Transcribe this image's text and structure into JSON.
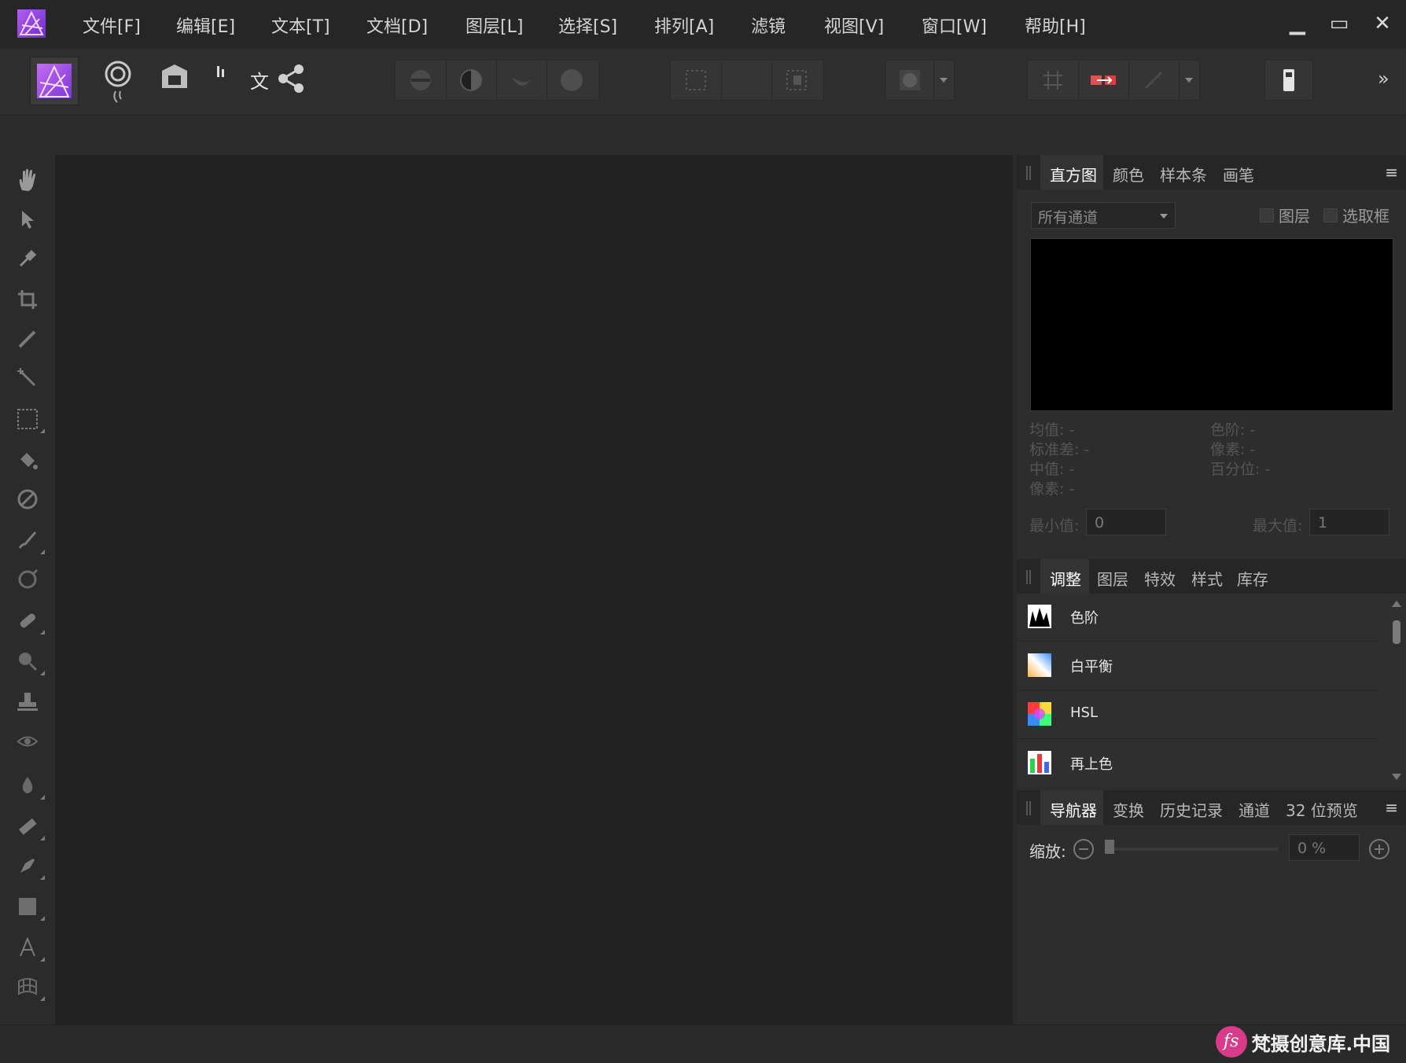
{
  "menubar": {
    "items": [
      "文件[F]",
      "编辑[E]",
      "文本[T]",
      "文档[D]",
      "图层[L]",
      "选择[S]",
      "排列[A]",
      "滤镜",
      "视图[V]",
      "窗口[W]",
      "帮助[H]"
    ],
    "window_controls": {
      "minimize": "▁",
      "maximize": "▭",
      "close": "✕"
    }
  },
  "toolbar": {
    "persona_icons": [
      "photo-persona-icon",
      "liquify-persona-icon",
      "develop-persona-icon",
      "tone-mapping-persona-icon",
      "export-persona-icon"
    ],
    "text_label": "文",
    "more_label": "»"
  },
  "histogram_panel": {
    "tabs": [
      "直方图",
      "颜色",
      "样本条",
      "画笔"
    ],
    "active_tab": "直方图",
    "channel_select": "所有通道",
    "checkbox_layer": "图层",
    "checkbox_marquee": "选取框",
    "stats_left": [
      "均值: -",
      "标准差: -",
      "中值: -",
      "像素: -"
    ],
    "stats_right": [
      "色阶: -",
      "像素: -",
      "百分位: -"
    ],
    "min_label": "最小值:",
    "min_value": "0",
    "max_label": "最大值:",
    "max_value": "1"
  },
  "adjustments_panel": {
    "tabs": [
      "调整",
      "图层",
      "特效",
      "样式",
      "库存"
    ],
    "active_tab": "调整",
    "items": [
      "色阶",
      "白平衡",
      "HSL",
      "再上色"
    ]
  },
  "navigator_panel": {
    "tabs": [
      "导航器",
      "变换",
      "历史记录",
      "通道",
      "32 位预览"
    ],
    "active_tab": "导航器",
    "zoom_label": "缩放:",
    "zoom_value": "0 %"
  },
  "watermark": {
    "logo": "fs",
    "text": "梵摄创意库.中国"
  },
  "colors": {
    "accent_logo": "#8a3fd1",
    "canvas": "#222222",
    "histogram_bg": "#000000"
  }
}
